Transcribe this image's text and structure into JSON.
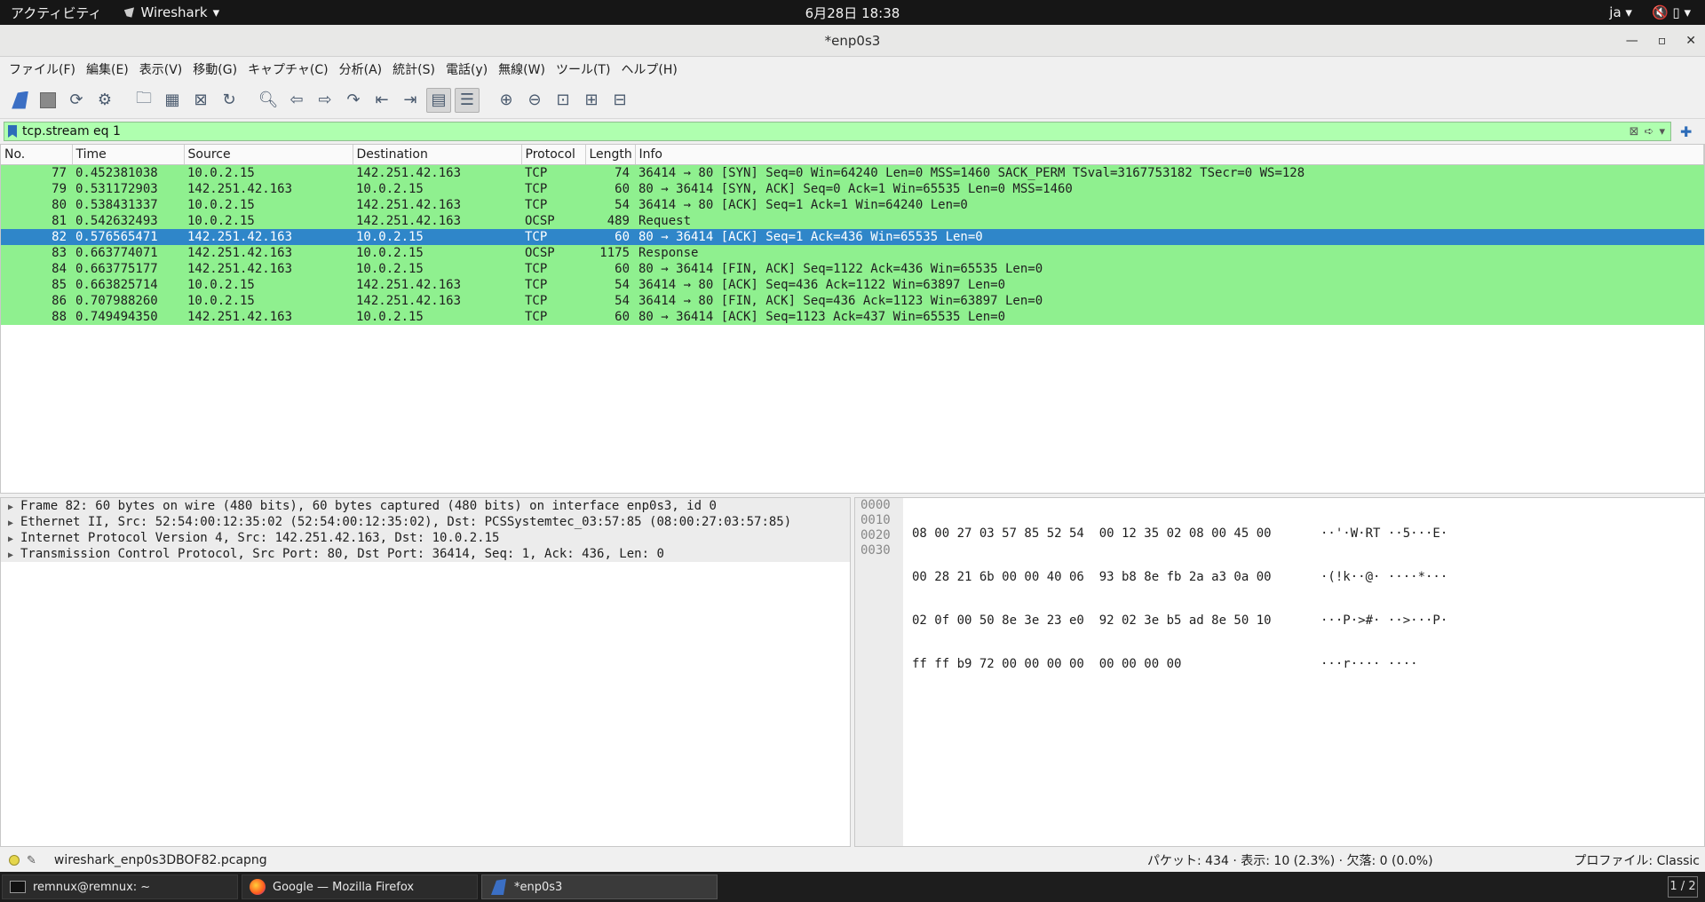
{
  "topbar": {
    "activities": "アクティビティ",
    "app_name": "Wireshark",
    "clock": "6月28日 18:38",
    "lang": "ja"
  },
  "window": {
    "title": "*enp0s3"
  },
  "menu": [
    "ファイル(F)",
    "編集(E)",
    "表示(V)",
    "移動(G)",
    "キャプチャ(C)",
    "分析(A)",
    "統計(S)",
    "電話(y)",
    "無線(W)",
    "ツール(T)",
    "ヘルプ(H)"
  ],
  "filter": {
    "value": "tcp.stream eq 1"
  },
  "columns": [
    "No.",
    "Time",
    "Source",
    "Destination",
    "Protocol",
    "Length",
    "Info"
  ],
  "packets": [
    {
      "no": "77",
      "time": "0.452381038",
      "src": "10.0.2.15",
      "dst": "142.251.42.163",
      "proto": "TCP",
      "len": "74",
      "info": "36414 → 80 [SYN] Seq=0 Win=64240 Len=0 MSS=1460 SACK_PERM TSval=3167753182 TSecr=0 WS=128"
    },
    {
      "no": "79",
      "time": "0.531172903",
      "src": "142.251.42.163",
      "dst": "10.0.2.15",
      "proto": "TCP",
      "len": "60",
      "info": "80 → 36414 [SYN, ACK] Seq=0 Ack=1 Win=65535 Len=0 MSS=1460"
    },
    {
      "no": "80",
      "time": "0.538431337",
      "src": "10.0.2.15",
      "dst": "142.251.42.163",
      "proto": "TCP",
      "len": "54",
      "info": "36414 → 80 [ACK] Seq=1 Ack=1 Win=64240 Len=0"
    },
    {
      "no": "81",
      "time": "0.542632493",
      "src": "10.0.2.15",
      "dst": "142.251.42.163",
      "proto": "OCSP",
      "len": "489",
      "info": "Request"
    },
    {
      "no": "82",
      "time": "0.576565471",
      "src": "142.251.42.163",
      "dst": "10.0.2.15",
      "proto": "TCP",
      "len": "60",
      "info": "80 → 36414 [ACK] Seq=1 Ack=436 Win=65535 Len=0"
    },
    {
      "no": "83",
      "time": "0.663774071",
      "src": "142.251.42.163",
      "dst": "10.0.2.15",
      "proto": "OCSP",
      "len": "1175",
      "info": "Response"
    },
    {
      "no": "84",
      "time": "0.663775177",
      "src": "142.251.42.163",
      "dst": "10.0.2.15",
      "proto": "TCP",
      "len": "60",
      "info": "80 → 36414 [FIN, ACK] Seq=1122 Ack=436 Win=65535 Len=0"
    },
    {
      "no": "85",
      "time": "0.663825714",
      "src": "10.0.2.15",
      "dst": "142.251.42.163",
      "proto": "TCP",
      "len": "54",
      "info": "36414 → 80 [ACK] Seq=436 Ack=1122 Win=63897 Len=0"
    },
    {
      "no": "86",
      "time": "0.707988260",
      "src": "10.0.2.15",
      "dst": "142.251.42.163",
      "proto": "TCP",
      "len": "54",
      "info": "36414 → 80 [FIN, ACK] Seq=436 Ack=1123 Win=63897 Len=0"
    },
    {
      "no": "88",
      "time": "0.749494350",
      "src": "142.251.42.163",
      "dst": "10.0.2.15",
      "proto": "TCP",
      "len": "60",
      "info": "80 → 36414 [ACK] Seq=1123 Ack=437 Win=65535 Len=0"
    }
  ],
  "selected_packet": "82",
  "details": [
    "Frame 82: 60 bytes on wire (480 bits), 60 bytes captured (480 bits) on interface enp0s3, id 0",
    "Ethernet II, Src: 52:54:00:12:35:02 (52:54:00:12:35:02), Dst: PCSSystemtec_03:57:85 (08:00:27:03:57:85)",
    "Internet Protocol Version 4, Src: 142.251.42.163, Dst: 10.0.2.15",
    "Transmission Control Protocol, Src Port: 80, Dst Port: 36414, Seq: 1, Ack: 436, Len: 0"
  ],
  "bytes": [
    {
      "off": "0000",
      "hex": "08 00 27 03 57 85 52 54  00 12 35 02 08 00 45 00",
      "ascii": "··'·W·RT ··5···E·"
    },
    {
      "off": "0010",
      "hex": "00 28 21 6b 00 00 40 06  93 b8 8e fb 2a a3 0a 00",
      "ascii": "·(!k··@· ····*···"
    },
    {
      "off": "0020",
      "hex": "02 0f 00 50 8e 3e 23 e0  92 02 3e b5 ad 8e 50 10",
      "ascii": "···P·>#· ··>···P·"
    },
    {
      "off": "0030",
      "hex": "ff ff b9 72 00 00 00 00  00 00 00 00",
      "ascii": "···r···· ····"
    }
  ],
  "status": {
    "filename": "wireshark_enp0s3DBOF82.pcapng",
    "stats": "パケット: 434 · 表示: 10 (2.3%) · 欠落: 0 (0.0%)",
    "profile": "プロファイル: Classic"
  },
  "taskbar": {
    "items": [
      "remnux@remnux: ~",
      "Google — Mozilla Firefox",
      "*enp0s3"
    ],
    "pager": "1 / 2"
  }
}
